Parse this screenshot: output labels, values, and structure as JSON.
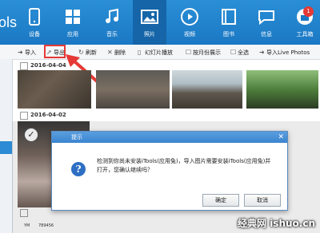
{
  "app": {
    "brand": "ols"
  },
  "nav": [
    {
      "label": "设备",
      "icon": "device-icon"
    },
    {
      "label": "应用",
      "icon": "apps-icon"
    },
    {
      "label": "音乐",
      "icon": "music-icon"
    },
    {
      "label": "照片",
      "icon": "photo-icon",
      "active": true
    },
    {
      "label": "视频",
      "icon": "video-icon"
    },
    {
      "label": "图书",
      "icon": "book-icon"
    },
    {
      "label": "信息",
      "icon": "message-icon"
    },
    {
      "label": "工具箱",
      "icon": "toolbox-icon",
      "badge": "1"
    }
  ],
  "toolbar": {
    "import": "导入",
    "export": "导出",
    "refresh": "刷新",
    "delete": "删除",
    "slideshow": "幻灯片播放",
    "by_month": "按月份展示",
    "select_all": "全选",
    "import_live": "导入Live Photos"
  },
  "groups": [
    {
      "date": "2016-04-04"
    },
    {
      "date": "2016-04-02"
    }
  ],
  "dialog": {
    "title": "提示",
    "message": "检测到你尚未安装iTools(应用兔)，导入图片需要安装iTools(应用兔)并打开，您确认继续吗？",
    "ok": "确定",
    "cancel": "取消"
  },
  "misc": {
    "footer_left": "YM",
    "footer_num": "789456"
  },
  "watermark": "经典网 ishuo.cn",
  "colors": {
    "header": "#1b78c4",
    "active_nav": "#1565a8",
    "highlight": "#e53935"
  }
}
